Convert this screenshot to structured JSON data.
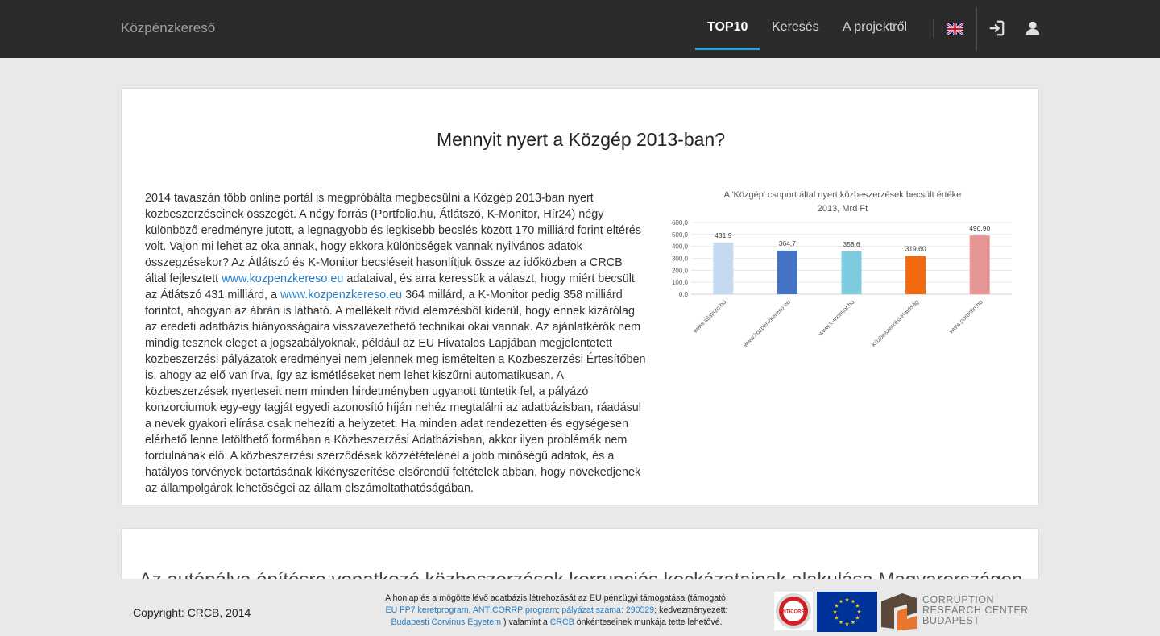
{
  "nav": {
    "brand": "Közpénzkereső",
    "links": [
      {
        "label": "TOP10",
        "active": true
      },
      {
        "label": "Keresés",
        "active": false
      },
      {
        "label": "A projektről",
        "active": false
      }
    ],
    "icons": [
      "uk-flag-icon",
      "login-icon",
      "user-icon"
    ]
  },
  "card1": {
    "title": "Mennyit nyert a Közgép 2013-ban?",
    "article": {
      "p1": "2014 tavaszán több online portál is megpróbálta megbecsülni a Közgép 2013-ban nyert közbeszerzéseinek összegét. A négy forrás (Portfolio.hu, Átlátszó, K-Monitor, Hír24) négy különböző eredményre jutott, a legnagyobb és legkisebb becslés között 170 milliárd forint eltérés volt. Vajon mi lehet az oka annak, hogy ekkora különbségek vannak nyilvános adatok összegzésekor? Az Átlátszó és K-Monitor becsléseit hasonlítjuk össze az időközben a CRCB által fejlesztett",
      "link1": "www.kozpenzkereso.eu",
      "p2": "adataival, és arra keressük a választ, hogy miért becsült az Átlátszó 431 milliárd, a",
      "link2": "www.kozpenzkereso.eu",
      "p3": "364 millárd, a K-Monitor pedig 358 milliárd forintot, ahogyan az ábrán is látható. A mellékelt rövid elemzésből kiderül, hogy ennek kizárólag az eredeti adatbázis hiányosságaira visszavezethető technikai okai vannak. Az ajánlatkérők nem mindig tesznek eleget a jogszabályoknak, például az EU Hivatalos Lapjában megjelentetett közbeszerzési pályázatok eredményei nem jelennek meg ismételten a Közbeszerzési Értesítőben is, ahogy az elő van írva, így az ismétléseket nem lehet kiszűrni automatikusan. A közbeszerzések nyerteseit nem minden hirdetményben ugyanott tüntetik fel, a pályázó konzorciumok egy-egy tagját egyedi azonosító híján nehéz megtalálni az adatbázisban, ráadásul a nevek gyakori elírása csak nehezíti a helyzetet. Ha minden adat rendezetten és egységesen elérhető lenne letölthető formában a Közbeszerzési Adatbázisban, akkor ilyen problémák nem fordulnának elő. A közbeszerzési szerződések közzétételénél a jobb minőségű adatok, és a hatályos törvények betartásának kikényszerítése elsőrendű feltételek abban, hogy növekedjenek az állampolgárok lehetőségei az állam elszámoltathatóságában."
    }
  },
  "chart_data": {
    "type": "bar",
    "title": "A 'Közgép' csoport által nyert közbeszerzések becsült értéke",
    "subtitle": "2013, Mrd Ft",
    "categories": [
      "www.atlatszo.hu",
      "www.kozpenzkereso.eu",
      "www.k-monitor.hu",
      "Közbeszerzési Hatóság",
      "www.portfolio.hu"
    ],
    "values": [
      431.9,
      364.7,
      358.6,
      319.6,
      490.9
    ],
    "data_labels": [
      "431,9",
      "364,7",
      "358,6",
      "319,60",
      "490,90"
    ],
    "colors": [
      "#c5d9f1",
      "#4472c4",
      "#7ecbe0",
      "#f26a10",
      "#e69595"
    ],
    "yticks": [
      "0,0",
      "100,0",
      "200,0",
      "300,0",
      "400,0",
      "500,0",
      "600,0"
    ],
    "ylim": [
      0,
      600
    ],
    "grid": true
  },
  "card2": {
    "title": "Az autópálya építésre vonatkozó közbeszerzések korrupciós kockázatainak alakulása Magyarországon"
  },
  "footer": {
    "copyright": "Copyright: CRCB, 2014",
    "funding_pre": "A honlap és a mögötte lévő adatbázis létrehozását az EU pénzügyi támogatása (támogató:",
    "funding_link1": "EU FP7 keretprogram, ANTICORRP program",
    "funding_sep": ";",
    "funding_link2": "pályázat száma: 290529",
    "funding_mid": "; kedvezményezett:",
    "funding_link3": "Budapesti Corvinus Egyetem",
    "funding_and": ") valamint a",
    "funding_link4": "CRCB",
    "funding_post": "önkénteseinek munkája tette lehetővé.",
    "crc_line1": "CORRUPTION",
    "crc_line2": "RESEARCH CENTER",
    "crc_line3": "BUDAPEST",
    "anticorrp_label": "ANTICORRP"
  }
}
